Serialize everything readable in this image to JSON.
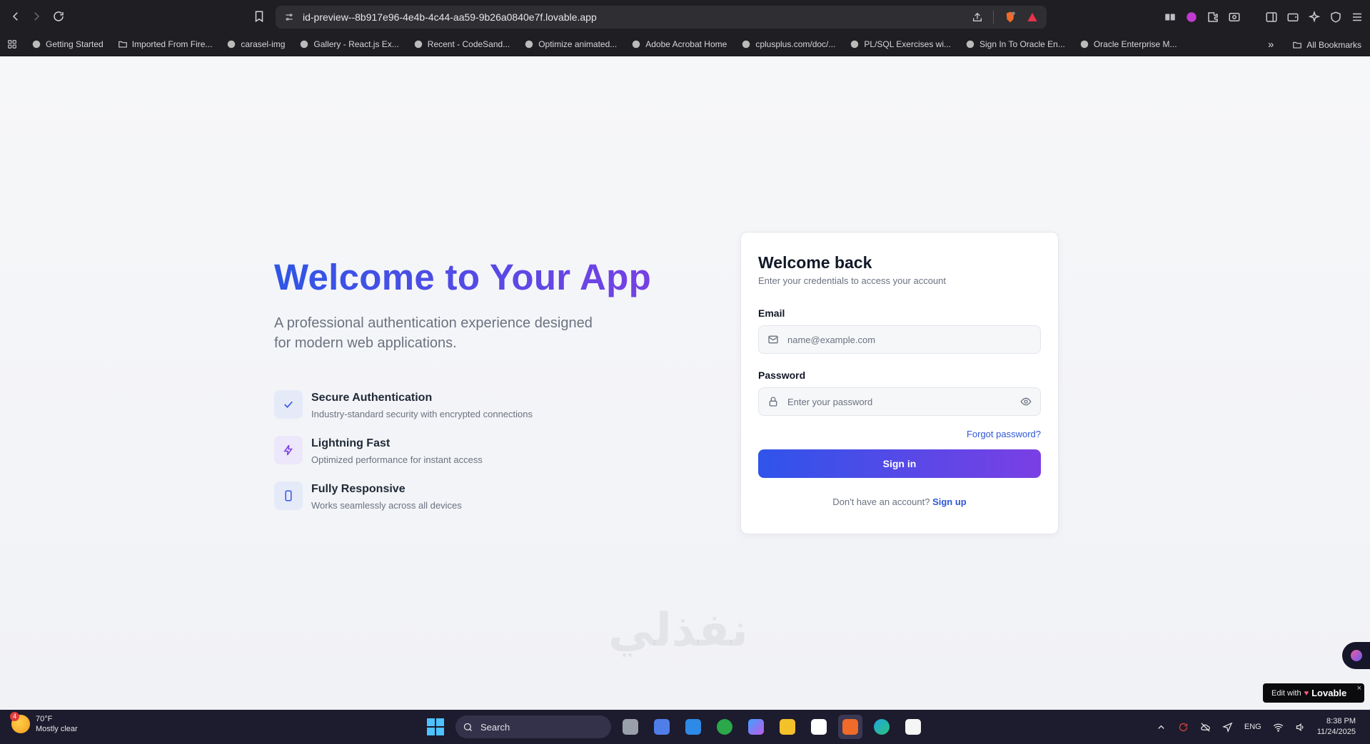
{
  "browser": {
    "url": "id-preview--8b917e96-4e4b-4c44-aa59-9b26a0840e7f.lovable.app",
    "bookmarks": [
      "Getting Started",
      "Imported From Fire...",
      "carasel-img",
      "Gallery - React.js Ex...",
      "Recent - CodeSand...",
      "Optimize animated...",
      "Adobe Acrobat Home",
      "cplusplus.com/doc/...",
      "PL/SQL Exercises wi...",
      "Sign In To Oracle En...",
      "Oracle Enterprise M..."
    ],
    "more_label": "»",
    "all_bookmarks": "All Bookmarks"
  },
  "hero": {
    "title": "Welcome to Your App",
    "subtitle": "A professional authentication experience designed for modern web applications."
  },
  "features": [
    {
      "title": "Secure Authentication",
      "desc": "Industry-standard security with encrypted connections",
      "icon": "check-icon"
    },
    {
      "title": "Lightning Fast",
      "desc": "Optimized performance for instant access",
      "icon": "lightning-icon"
    },
    {
      "title": "Fully Responsive",
      "desc": "Works seamlessly across all devices",
      "icon": "phone-icon"
    }
  ],
  "login": {
    "title": "Welcome back",
    "subtitle": "Enter your credentials to access your account",
    "email_label": "Email",
    "email_placeholder": "name@example.com",
    "password_label": "Password",
    "password_placeholder": "Enter your password",
    "forgot": "Forgot password?",
    "submit": "Sign in",
    "no_account": "Don't have an account?",
    "signup": "Sign up"
  },
  "badge": {
    "edit_with": "Edit with",
    "brand": "Lovable",
    "close": "×"
  },
  "watermark": "نفذلي",
  "taskbar": {
    "temp": "70°F",
    "weather": "Mostly clear",
    "weather_badge": "4",
    "search": "Search",
    "lang": "ENG",
    "time": "8:38 PM",
    "date": "11/24/2025"
  },
  "colors": {
    "accent_blue": "#2f56e6",
    "accent_purple": "#7a3fe4",
    "link": "#2f56d6"
  }
}
